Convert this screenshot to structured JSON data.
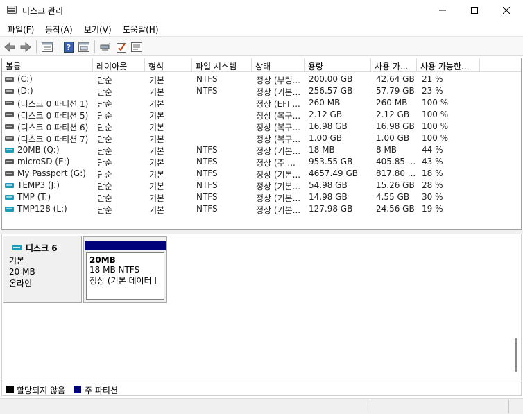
{
  "window": {
    "title": "디스크 관리",
    "minimize_label": "minimize",
    "maximize_label": "maximize",
    "close_label": "close"
  },
  "menu": [
    {
      "label": "파일(F)"
    },
    {
      "label": "동작(A)"
    },
    {
      "label": "보기(V)"
    },
    {
      "label": "도움말(H)"
    }
  ],
  "toolbar": {
    "icons": [
      "back-icon",
      "forward-icon",
      "volume-list-icon",
      "help-icon",
      "disk-view-icon",
      "connect-icon",
      "check-icon",
      "properties-icon"
    ]
  },
  "volume_list": {
    "columns": [
      "볼륨",
      "레이아웃",
      "형식",
      "파일 시스템",
      "상태",
      "용량",
      "사용 가...",
      "사용 가능한..."
    ],
    "rows": [
      {
        "name": "(C:)",
        "layout": "단순",
        "type": "기본",
        "fs": "NTFS",
        "status": "정상 (부팅...",
        "capacity": "200.00 GB",
        "free": "42.64 GB",
        "pct": "21 %",
        "icon": "gray"
      },
      {
        "name": "(D:)",
        "layout": "단순",
        "type": "기본",
        "fs": "NTFS",
        "status": "정상 (기본...",
        "capacity": "256.57 GB",
        "free": "57.79 GB",
        "pct": "23 %",
        "icon": "gray"
      },
      {
        "name": "(디스크 0 파티션 1)",
        "layout": "단순",
        "type": "기본",
        "fs": "",
        "status": "정상 (EFI ...",
        "capacity": "260 MB",
        "free": "260 MB",
        "pct": "100 %",
        "icon": "gray"
      },
      {
        "name": "(디스크 0 파티션 5)",
        "layout": "단순",
        "type": "기본",
        "fs": "",
        "status": "정상 (복구...",
        "capacity": "2.12 GB",
        "free": "2.12 GB",
        "pct": "100 %",
        "icon": "gray"
      },
      {
        "name": "(디스크 0 파티션 6)",
        "layout": "단순",
        "type": "기본",
        "fs": "",
        "status": "정상 (복구...",
        "capacity": "16.98 GB",
        "free": "16.98 GB",
        "pct": "100 %",
        "icon": "gray"
      },
      {
        "name": "(디스크 0 파티션 7)",
        "layout": "단순",
        "type": "기본",
        "fs": "",
        "status": "정상 (복구...",
        "capacity": "1.00 GB",
        "free": "1.00 GB",
        "pct": "100 %",
        "icon": "gray"
      },
      {
        "name": "20MB (Q:)",
        "layout": "단순",
        "type": "기본",
        "fs": "NTFS",
        "status": "정상 (기본...",
        "capacity": "18 MB",
        "free": "8 MB",
        "pct": "44 %",
        "icon": "teal"
      },
      {
        "name": "microSD (E:)",
        "layout": "단순",
        "type": "기본",
        "fs": "NTFS",
        "status": "정상 (주 ...",
        "capacity": "953.55 GB",
        "free": "405.85 ...",
        "pct": "43 %",
        "icon": "gray"
      },
      {
        "name": "My Passport (G:)",
        "layout": "단순",
        "type": "기본",
        "fs": "NTFS",
        "status": "정상 (기본...",
        "capacity": "4657.49 GB",
        "free": "817.80 ...",
        "pct": "18 %",
        "icon": "gray"
      },
      {
        "name": "TEMP3 (J:)",
        "layout": "단순",
        "type": "기본",
        "fs": "NTFS",
        "status": "정상 (기본...",
        "capacity": "54.98 GB",
        "free": "15.26 GB",
        "pct": "28 %",
        "icon": "teal"
      },
      {
        "name": "TMP (T:)",
        "layout": "단순",
        "type": "기본",
        "fs": "NTFS",
        "status": "정상 (기본...",
        "capacity": "14.98 GB",
        "free": "4.55 GB",
        "pct": "30 %",
        "icon": "teal"
      },
      {
        "name": "TMP128 (L:)",
        "layout": "단순",
        "type": "기본",
        "fs": "NTFS",
        "status": "정상 (기본...",
        "capacity": "127.98 GB",
        "free": "24.56 GB",
        "pct": "19 %",
        "icon": "teal"
      }
    ]
  },
  "disk": {
    "name": "디스크 6",
    "type": "기본",
    "size": "20 MB",
    "state": "온라인",
    "partition": {
      "label": "20MB",
      "size_fs": "18 MB NTFS",
      "status": "정상 (기본 데이터 I"
    }
  },
  "legend": {
    "unallocated": "할당되지 않음",
    "primary": "주 파티션"
  },
  "colors": {
    "teal": "#1e9db8",
    "gray": "#5a5a5a",
    "primary_partition": "#00007b",
    "unallocated": "#000000"
  }
}
